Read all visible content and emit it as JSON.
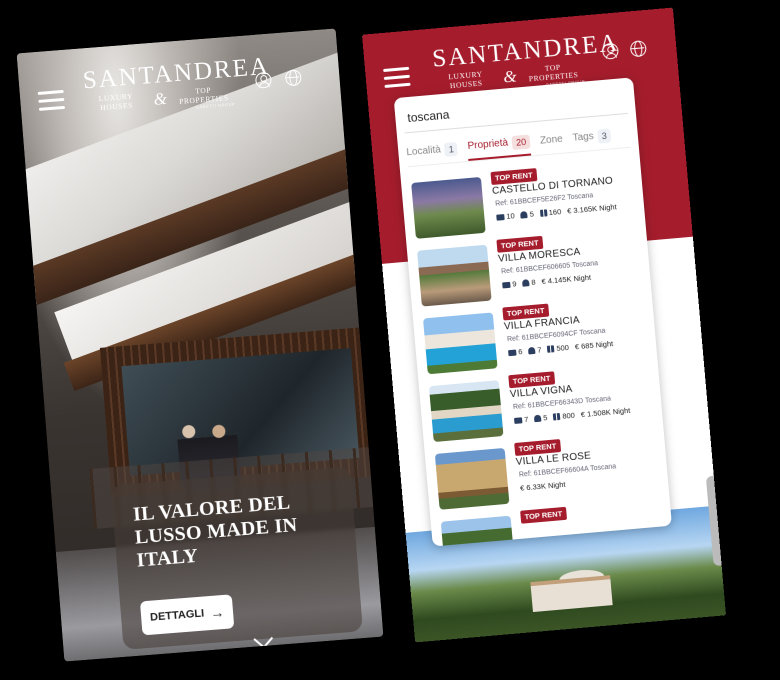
{
  "brand": {
    "name": "SANTANDREA",
    "left_sub": "LUXURY HOUSES",
    "ampersand": "&",
    "right_sub": "TOP PROPERTIES",
    "group": "GABETTI GROUP"
  },
  "left_screen": {
    "hero_title": "IL VALORE DEL LUSSO MADE IN ITALY",
    "cta_label": "DETTAGLI",
    "cta_arrow": "→"
  },
  "right_screen": {
    "search": {
      "value": "toscana"
    },
    "tabs": [
      {
        "label": "Località",
        "count": "1"
      },
      {
        "label": "Proprietà",
        "count": "20"
      },
      {
        "label": "Zone",
        "count": ""
      },
      {
        "label": "Tags",
        "count": "3"
      }
    ],
    "active_tab": "Proprietà",
    "results": [
      {
        "badge": "TOP RENT",
        "name": "CASTELLO DI TORNANO",
        "ref": "Ref: 61BBCEF5E26F2  Toscana",
        "beds": "10",
        "baths": "5",
        "sqm": "160",
        "price": "€ 3.165K Night"
      },
      {
        "badge": "TOP RENT",
        "name": "VILLA MORESCA",
        "ref": "Ref: 61BBCEF606605  Toscana",
        "beds": "9",
        "baths": "8",
        "sqm": "",
        "price": "€ 4.145K Night"
      },
      {
        "badge": "TOP RENT",
        "name": "VILLA FRANCIA",
        "ref": "Ref: 61BBCEF6094CF  Toscana",
        "beds": "6",
        "baths": "7",
        "sqm": "500",
        "price": "€ 685 Night"
      },
      {
        "badge": "TOP RENT",
        "name": "VILLA VIGNA",
        "ref": "Ref: 61BBCEF66343D  Toscana",
        "beds": "7",
        "baths": "5",
        "sqm": "800",
        "price": "€ 1.508K Night"
      },
      {
        "badge": "TOP RENT",
        "name": "VILLA LE ROSE",
        "ref": "Ref: 61BBCEF66604A  Toscana",
        "beds": "",
        "baths": "",
        "sqm": "",
        "price": "€ 6.33K Night"
      },
      {
        "badge": "TOP RENT"
      }
    ]
  },
  "colors": {
    "brand_red": "#a51d2d",
    "white": "#ffffff",
    "black": "#000000"
  },
  "icons": [
    "menu-icon",
    "user-icon",
    "globe-icon",
    "arrow-right-icon",
    "chevron-down-icon",
    "bed-icon",
    "bath-icon",
    "area-icon"
  ]
}
